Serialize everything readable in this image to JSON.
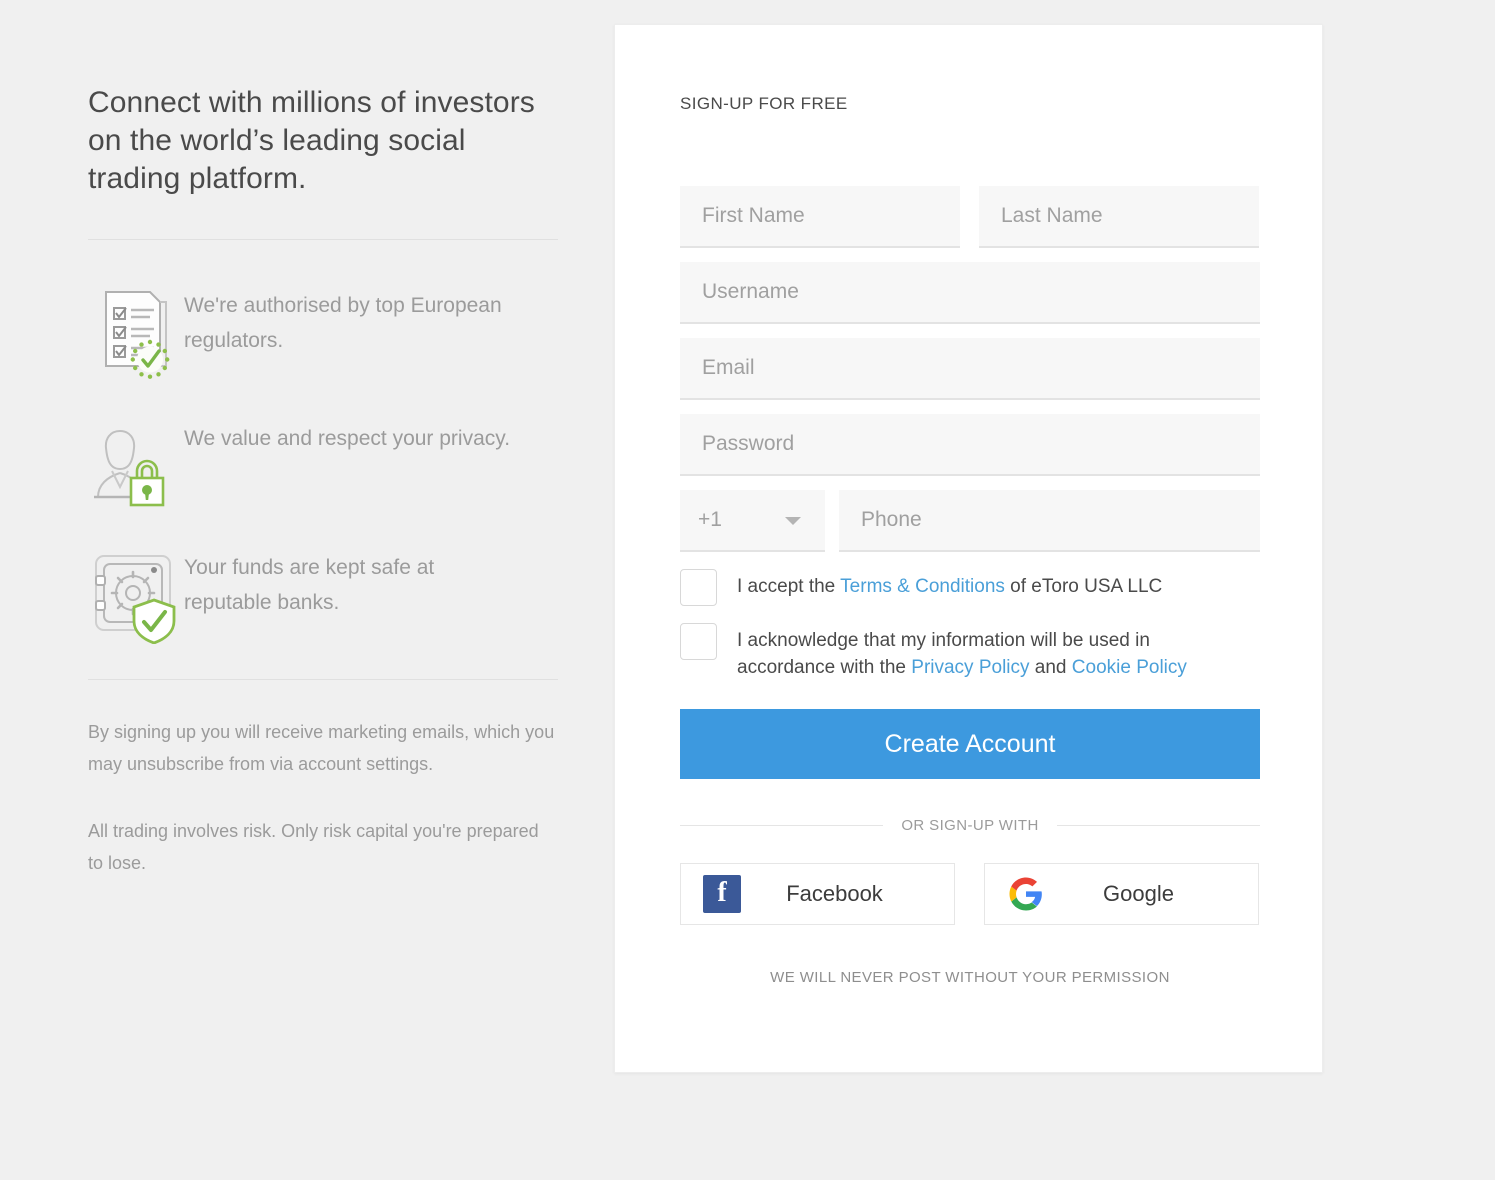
{
  "left": {
    "headline": "Connect with millions of investors on the world’s leading social trading platform.",
    "features": [
      {
        "icon": "checklist-verified-icon",
        "text": "We're authorised by top European regulators."
      },
      {
        "icon": "person-lock-icon",
        "text": "We value and respect your privacy."
      },
      {
        "icon": "safe-shield-icon",
        "text": "Your funds are kept safe at reputable banks."
      }
    ],
    "legal": [
      "By signing up you will receive marketing emails, which you may unsubscribe from via account settings.",
      "All trading involves risk. Only risk capital you're prepared to lose."
    ]
  },
  "form": {
    "title": "SIGN-UP FOR FREE",
    "fields": {
      "first_name": {
        "value": "",
        "placeholder": "First Name"
      },
      "last_name": {
        "value": "",
        "placeholder": "Last Name"
      },
      "username": {
        "value": "",
        "placeholder": "Username"
      },
      "email": {
        "value": "",
        "placeholder": "Email"
      },
      "password": {
        "value": "",
        "placeholder": "Password"
      },
      "country_code": {
        "value": "+1",
        "options": [
          "+1"
        ]
      },
      "phone": {
        "value": "",
        "placeholder": "Phone"
      }
    },
    "terms": {
      "checked": false,
      "prefix": "I accept the ",
      "link": "Terms & Conditions",
      "suffix": " of eToro USA LLC"
    },
    "privacy": {
      "checked": false,
      "prefix": "I acknowledge that my information will be used in accordance with the ",
      "link1": "Privacy Policy",
      "middle": " and ",
      "link2": "Cookie Policy"
    },
    "submit_label": "Create Account",
    "or_text": "OR SIGN-UP WITH",
    "social": [
      {
        "id": "facebook",
        "label": "Facebook",
        "icon": "facebook-icon"
      },
      {
        "id": "google",
        "label": "Google",
        "icon": "google-icon"
      }
    ],
    "footer_note": "WE WILL NEVER POST WITHOUT YOUR PERMISSION"
  },
  "colors": {
    "page_bg": "#f0f0f0",
    "card_bg": "#ffffff",
    "primary_button": "#3d99df",
    "link": "#4a9fd8",
    "facebook_blue": "#3b5998",
    "google_blue": "#4285f4",
    "google_red": "#ea4335",
    "google_yellow": "#fbbc05",
    "google_green": "#34a853",
    "accent_green": "#7ab648",
    "input_bg": "#f7f7f7",
    "muted_text": "#9b9b9b",
    "heading_text": "#4a4a4a"
  }
}
